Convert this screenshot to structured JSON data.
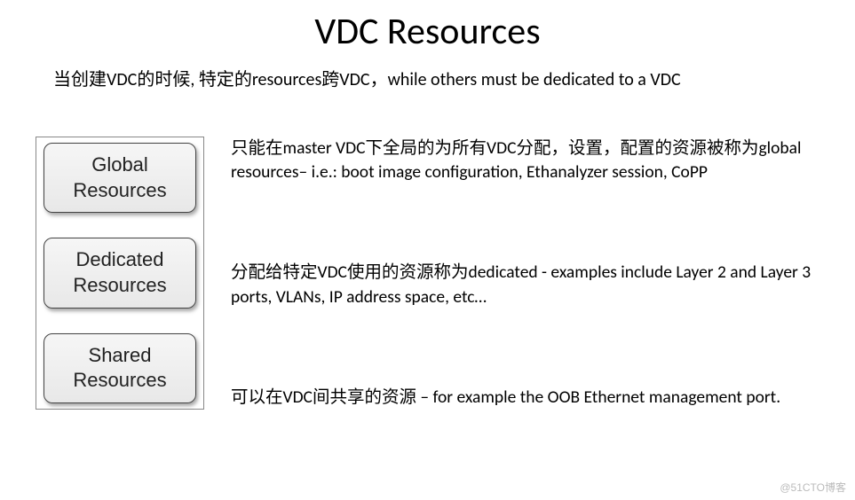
{
  "title": "VDC Resources",
  "intro": "当创建VDC的时候, 特定的resources跨VDC，while others must be dedicated to a VDC",
  "boxes": {
    "global": "Global Resources",
    "dedicated": "Dedicated Resources",
    "shared": "Shared Resources"
  },
  "descriptions": {
    "global": "只能在master VDC下全局的为所有VDC分配，设置，配置的资源被称为global resources– i.e.: boot image configuration, Ethanalyzer session, CoPP",
    "dedicated": "分配给特定VDC使用的资源称为dedicated - examples include Layer 2 and Layer 3 ports, VLANs, IP address space, etc…",
    "shared": "可以在VDC间共享的资源 – for example the OOB Ethernet management port."
  },
  "watermark": "@51CTO博客"
}
